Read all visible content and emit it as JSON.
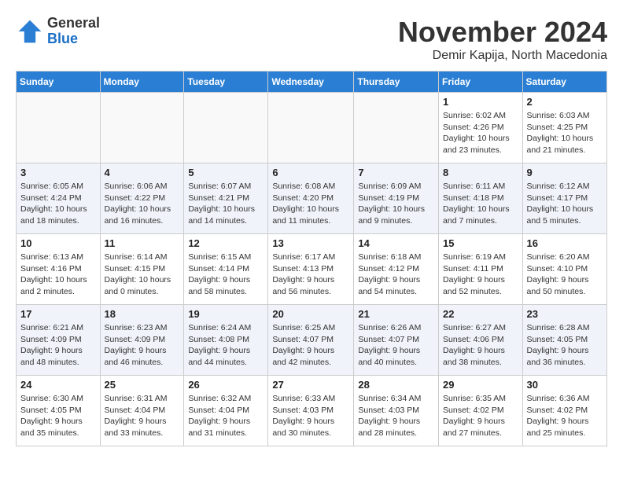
{
  "header": {
    "logo_general": "General",
    "logo_blue": "Blue",
    "month": "November 2024",
    "location": "Demir Kapija, North Macedonia"
  },
  "days_of_week": [
    "Sunday",
    "Monday",
    "Tuesday",
    "Wednesday",
    "Thursday",
    "Friday",
    "Saturday"
  ],
  "weeks": [
    [
      {
        "day": "",
        "info": ""
      },
      {
        "day": "",
        "info": ""
      },
      {
        "day": "",
        "info": ""
      },
      {
        "day": "",
        "info": ""
      },
      {
        "day": "",
        "info": ""
      },
      {
        "day": "1",
        "info": "Sunrise: 6:02 AM\nSunset: 4:26 PM\nDaylight: 10 hours\nand 23 minutes."
      },
      {
        "day": "2",
        "info": "Sunrise: 6:03 AM\nSunset: 4:25 PM\nDaylight: 10 hours\nand 21 minutes."
      }
    ],
    [
      {
        "day": "3",
        "info": "Sunrise: 6:05 AM\nSunset: 4:24 PM\nDaylight: 10 hours\nand 18 minutes."
      },
      {
        "day": "4",
        "info": "Sunrise: 6:06 AM\nSunset: 4:22 PM\nDaylight: 10 hours\nand 16 minutes."
      },
      {
        "day": "5",
        "info": "Sunrise: 6:07 AM\nSunset: 4:21 PM\nDaylight: 10 hours\nand 14 minutes."
      },
      {
        "day": "6",
        "info": "Sunrise: 6:08 AM\nSunset: 4:20 PM\nDaylight: 10 hours\nand 11 minutes."
      },
      {
        "day": "7",
        "info": "Sunrise: 6:09 AM\nSunset: 4:19 PM\nDaylight: 10 hours\nand 9 minutes."
      },
      {
        "day": "8",
        "info": "Sunrise: 6:11 AM\nSunset: 4:18 PM\nDaylight: 10 hours\nand 7 minutes."
      },
      {
        "day": "9",
        "info": "Sunrise: 6:12 AM\nSunset: 4:17 PM\nDaylight: 10 hours\nand 5 minutes."
      }
    ],
    [
      {
        "day": "10",
        "info": "Sunrise: 6:13 AM\nSunset: 4:16 PM\nDaylight: 10 hours\nand 2 minutes."
      },
      {
        "day": "11",
        "info": "Sunrise: 6:14 AM\nSunset: 4:15 PM\nDaylight: 10 hours\nand 0 minutes."
      },
      {
        "day": "12",
        "info": "Sunrise: 6:15 AM\nSunset: 4:14 PM\nDaylight: 9 hours\nand 58 minutes."
      },
      {
        "day": "13",
        "info": "Sunrise: 6:17 AM\nSunset: 4:13 PM\nDaylight: 9 hours\nand 56 minutes."
      },
      {
        "day": "14",
        "info": "Sunrise: 6:18 AM\nSunset: 4:12 PM\nDaylight: 9 hours\nand 54 minutes."
      },
      {
        "day": "15",
        "info": "Sunrise: 6:19 AM\nSunset: 4:11 PM\nDaylight: 9 hours\nand 52 minutes."
      },
      {
        "day": "16",
        "info": "Sunrise: 6:20 AM\nSunset: 4:10 PM\nDaylight: 9 hours\nand 50 minutes."
      }
    ],
    [
      {
        "day": "17",
        "info": "Sunrise: 6:21 AM\nSunset: 4:09 PM\nDaylight: 9 hours\nand 48 minutes."
      },
      {
        "day": "18",
        "info": "Sunrise: 6:23 AM\nSunset: 4:09 PM\nDaylight: 9 hours\nand 46 minutes."
      },
      {
        "day": "19",
        "info": "Sunrise: 6:24 AM\nSunset: 4:08 PM\nDaylight: 9 hours\nand 44 minutes."
      },
      {
        "day": "20",
        "info": "Sunrise: 6:25 AM\nSunset: 4:07 PM\nDaylight: 9 hours\nand 42 minutes."
      },
      {
        "day": "21",
        "info": "Sunrise: 6:26 AM\nSunset: 4:07 PM\nDaylight: 9 hours\nand 40 minutes."
      },
      {
        "day": "22",
        "info": "Sunrise: 6:27 AM\nSunset: 4:06 PM\nDaylight: 9 hours\nand 38 minutes."
      },
      {
        "day": "23",
        "info": "Sunrise: 6:28 AM\nSunset: 4:05 PM\nDaylight: 9 hours\nand 36 minutes."
      }
    ],
    [
      {
        "day": "24",
        "info": "Sunrise: 6:30 AM\nSunset: 4:05 PM\nDaylight: 9 hours\nand 35 minutes."
      },
      {
        "day": "25",
        "info": "Sunrise: 6:31 AM\nSunset: 4:04 PM\nDaylight: 9 hours\nand 33 minutes."
      },
      {
        "day": "26",
        "info": "Sunrise: 6:32 AM\nSunset: 4:04 PM\nDaylight: 9 hours\nand 31 minutes."
      },
      {
        "day": "27",
        "info": "Sunrise: 6:33 AM\nSunset: 4:03 PM\nDaylight: 9 hours\nand 30 minutes."
      },
      {
        "day": "28",
        "info": "Sunrise: 6:34 AM\nSunset: 4:03 PM\nDaylight: 9 hours\nand 28 minutes."
      },
      {
        "day": "29",
        "info": "Sunrise: 6:35 AM\nSunset: 4:02 PM\nDaylight: 9 hours\nand 27 minutes."
      },
      {
        "day": "30",
        "info": "Sunrise: 6:36 AM\nSunset: 4:02 PM\nDaylight: 9 hours\nand 25 minutes."
      }
    ]
  ]
}
